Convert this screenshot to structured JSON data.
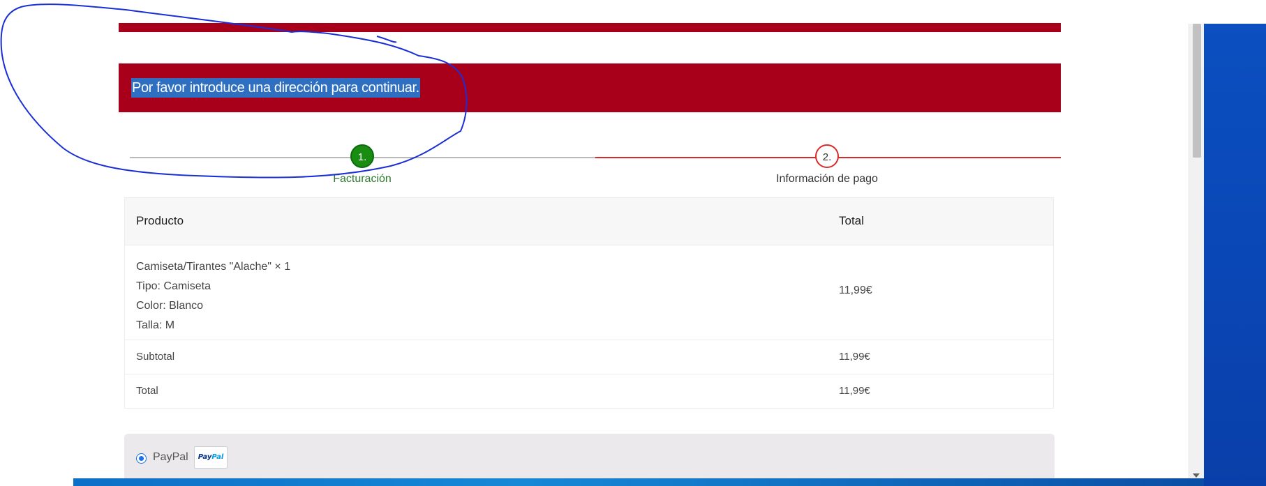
{
  "notice": {
    "message": "Por favor introduce una dirección para continuar."
  },
  "stepper": {
    "steps": [
      {
        "number": "1.",
        "label": "Facturación",
        "state": "active"
      },
      {
        "number": "2.",
        "label": "Información de pago",
        "state": "pending"
      }
    ]
  },
  "order": {
    "header": {
      "product": "Producto",
      "total": "Total"
    },
    "items": [
      {
        "lines": [
          "Camiseta/Tirantes \"Alache\"  × 1",
          "Tipo: Camiseta",
          "Color: Blanco",
          "Talla: M"
        ],
        "total": "11,99€"
      }
    ],
    "subtotal_label": "Subtotal",
    "subtotal_value": "11,99€",
    "total_label": "Total",
    "total_value": "11,99€"
  },
  "payment": {
    "method_label": "PayPal",
    "logo": {
      "pay": "Pay",
      "pal": "Pal"
    },
    "selected": true
  },
  "colors": {
    "brand_red": "#a8001b",
    "step_active": "#1a8c12",
    "step_pending_border": "#d62b2b",
    "selection_highlight": "#2f6fc1",
    "annotation_ink": "#1a2fd6",
    "desktop_blue": "#0b4fc0"
  },
  "icons": {
    "scroll_down": "chevron-down-icon",
    "radio": "radio-selected-icon"
  }
}
